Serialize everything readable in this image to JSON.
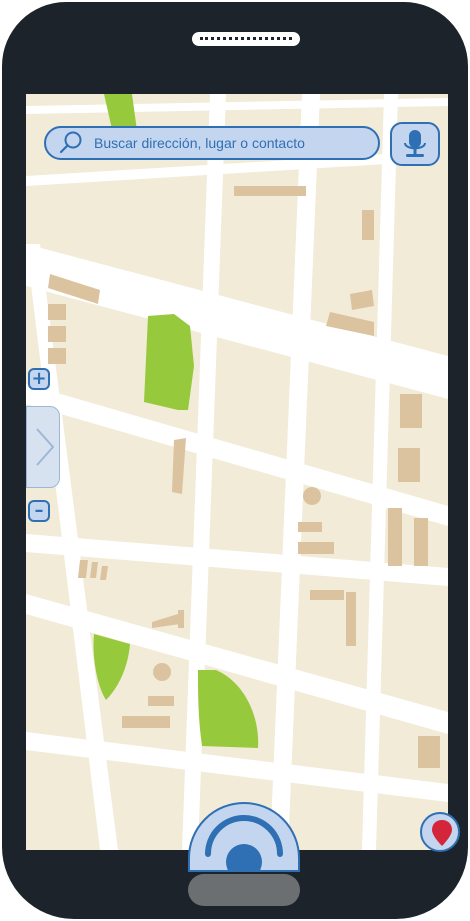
{
  "search": {
    "placeholder": "Buscar dirección, lugar o contacto"
  },
  "controls": {
    "zoom_in_label": "+",
    "zoom_out_label": "–"
  },
  "icons": {
    "search": "search-icon",
    "microphone": "microphone-icon",
    "panel_expand": "chevron-right-icon",
    "navigation": "navigation-icon",
    "location_pin": "map-pin-icon"
  },
  "colors": {
    "accent": "#2f6fb3",
    "control_fill": "#c4d6ef",
    "map_land": "#f1ebd7",
    "park": "#97c93d",
    "building": "#dcc3a0",
    "pin": "#d3263a",
    "phone_body": "#1c232b"
  }
}
